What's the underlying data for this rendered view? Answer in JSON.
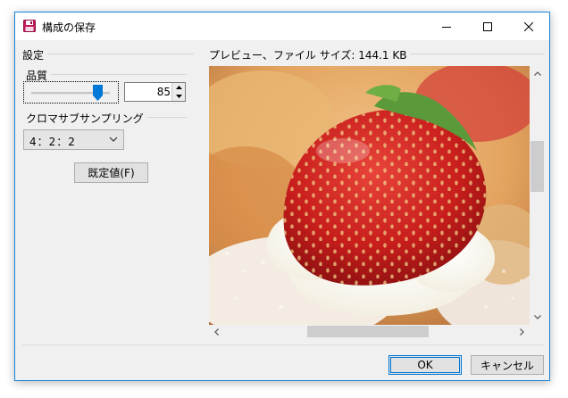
{
  "window": {
    "title": "構成の保存",
    "icon": "floppy-disk-icon",
    "controls": [
      "minimize-icon",
      "maximize-icon",
      "close-icon"
    ]
  },
  "settings": {
    "group_label": "設定",
    "quality": {
      "label": "品質",
      "value": "85",
      "slider_fraction": 0.85
    },
    "chroma": {
      "label": "クロマサブサンプリング",
      "selected": "4：2：2"
    },
    "default_button": "既定値(F)"
  },
  "preview": {
    "label": "プレビュー、ファイル サイズ: 144.1 KB",
    "image": "strawberry-cream-pastry-photo"
  },
  "buttons": {
    "ok": "OK",
    "cancel": "キャンセル"
  },
  "colors": {
    "accent": "#0078d7",
    "window_border": "#1883d7",
    "slider_thumb": "#0078d7"
  }
}
